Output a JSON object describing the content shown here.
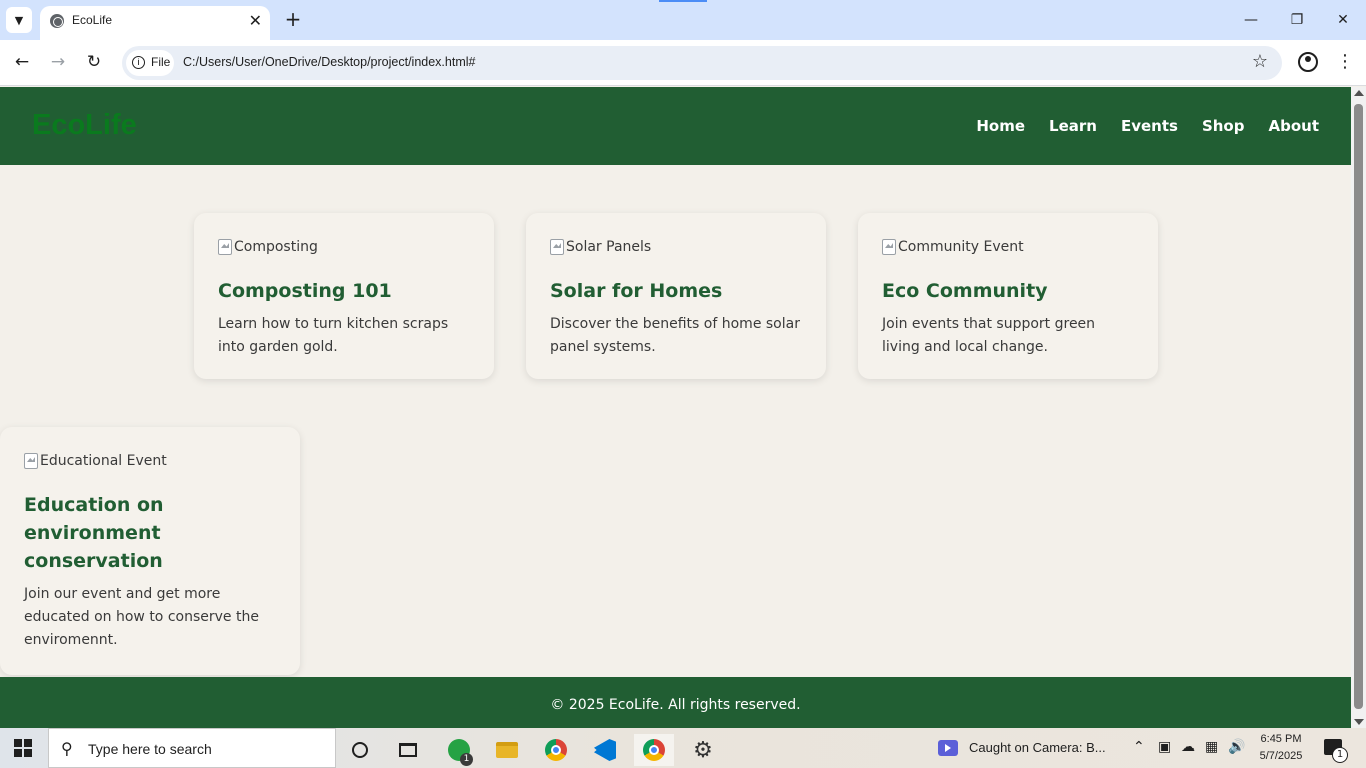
{
  "browser": {
    "tab_title": "EcoLife",
    "url_chip": "File",
    "url": "C:/Users/User/OneDrive/Desktop/project/index.html#"
  },
  "site": {
    "logo": "EcoLife",
    "nav": [
      "Home",
      "Learn",
      "Events",
      "Shop",
      "About"
    ],
    "cards": [
      {
        "img_alt": "Composting",
        "title": "Composting 101",
        "desc": "Learn how to turn kitchen scraps into garden gold."
      },
      {
        "img_alt": "Solar Panels",
        "title": "Solar for Homes",
        "desc": "Discover the benefits of home solar panel systems."
      },
      {
        "img_alt": "Community Event",
        "title": "Eco Community",
        "desc": "Join events that support green living and local change."
      },
      {
        "img_alt": "Educational Event",
        "title": "Education on environment conservation",
        "desc": "Join our event and get more educated on how to conserve the enviromennt."
      }
    ],
    "footer": "© 2025 EcoLife. All rights reserved."
  },
  "taskbar": {
    "search_placeholder": "Type here to search",
    "whatsapp_badge": "1",
    "media_title": "Caught on Camera: B...",
    "time": "6:45 PM",
    "date": "5/7/2025",
    "notification_badge": "1"
  },
  "colors": {
    "header_green": "#215e33",
    "logo_green": "#0a7a1e",
    "page_bg": "#f3f0ea"
  }
}
